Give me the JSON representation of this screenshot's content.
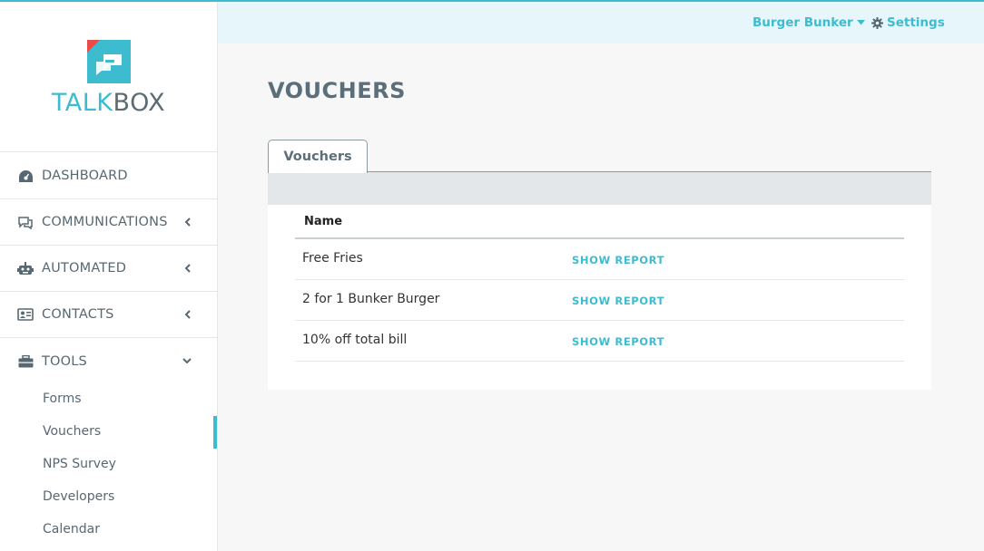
{
  "brand": {
    "name_part1": "TALK",
    "name_part2": "BOX",
    "accent_color": "#3dbcd0",
    "logo_icon": "chat-bubbles-icon"
  },
  "header": {
    "account_label": "Burger Bunker",
    "settings_label": "Settings"
  },
  "sidebar": {
    "items": [
      {
        "label": "DASHBOARD",
        "icon": "gauge-icon"
      },
      {
        "label": "COMMUNICATIONS",
        "icon": "chat-icon",
        "chevron": "left"
      },
      {
        "label": "AUTOMATED",
        "icon": "robot-icon",
        "chevron": "left"
      },
      {
        "label": "CONTACTS",
        "icon": "address-card-icon",
        "chevron": "left"
      },
      {
        "label": "TOOLS",
        "icon": "toolbox-icon",
        "chevron": "down"
      }
    ],
    "sub_items": [
      {
        "label": "Forms"
      },
      {
        "label": "Vouchers",
        "active": true
      },
      {
        "label": "NPS Survey"
      },
      {
        "label": "Developers"
      },
      {
        "label": "Calendar"
      }
    ]
  },
  "main": {
    "title": "VOUCHERS",
    "tab_label": "Vouchers",
    "table": {
      "column_name": "Name",
      "rows": [
        {
          "name": "Free Fries",
          "action": "SHOW REPORT"
        },
        {
          "name": "2 for 1 Bunker Burger",
          "action": "SHOW REPORT"
        },
        {
          "name": "10% off total bill",
          "action": "SHOW REPORT"
        }
      ]
    }
  }
}
